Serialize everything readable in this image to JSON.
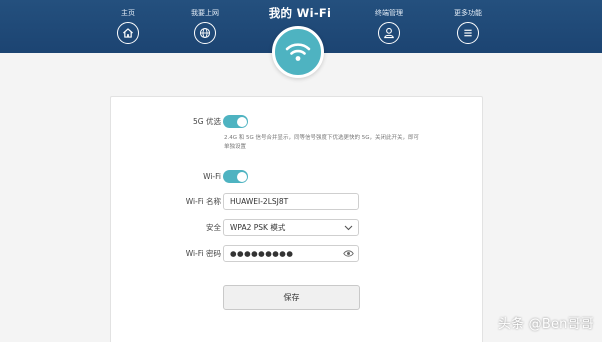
{
  "header": {
    "title": "我的 Wi-Fi",
    "nav": [
      {
        "label": "主页",
        "icon": "home-icon"
      },
      {
        "label": "我要上网",
        "icon": "globe-icon"
      },
      {
        "label": "终端管理",
        "icon": "user-icon"
      },
      {
        "label": "更多功能",
        "icon": "menu-icon"
      }
    ],
    "center_icon": "wifi-icon"
  },
  "form": {
    "g5_label": "5G 优选",
    "g5_enabled": true,
    "g5_hint": "2.4G 和 5G 信号合并显示，同等信号强度下优选更快的 5G，关闭此开关，即可单独设置",
    "wifi_label": "Wi-Fi",
    "wifi_enabled": true,
    "name_label": "Wi-Fi 名称",
    "name_value": "HUAWEI-2LSJ8T",
    "security_label": "安全",
    "security_value": "WPA2 PSK 模式",
    "password_label": "Wi-Fi 密码",
    "password_value": "●●●●●●●●●",
    "save_label": "保存"
  },
  "watermark": "头条 @Ben哥哥",
  "colors": {
    "header_bg": "#1f4a78",
    "accent": "#4eb3c1",
    "card_bg": "#ffffff",
    "page_bg": "#f4f4f4"
  }
}
